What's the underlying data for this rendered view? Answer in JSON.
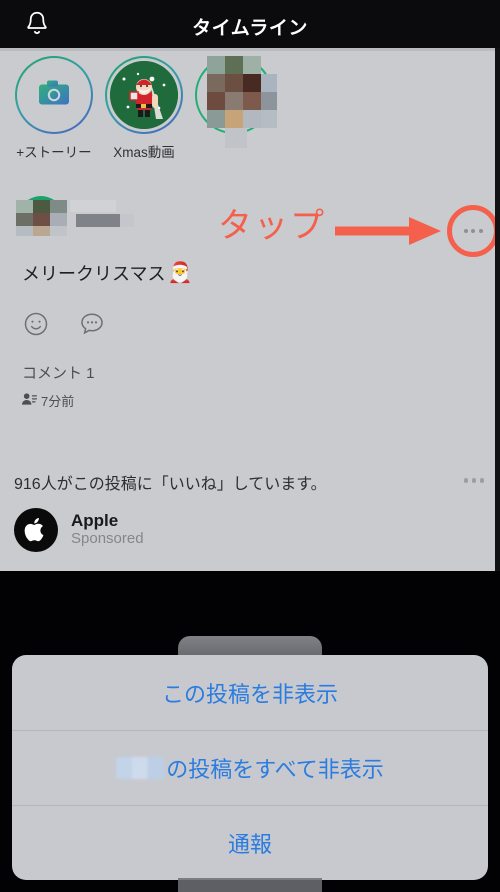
{
  "header": {
    "title": "タイムライン",
    "bell_icon": "bell-icon",
    "background": "#0b0b0d",
    "text_color": "#ffffff"
  },
  "stories": [
    {
      "label": "+ストーリー",
      "icon": "camera-icon",
      "type": "add-story",
      "ring_colors": [
        "#20a26a",
        "#4a62c0"
      ]
    },
    {
      "label": "Xmas動画",
      "icon": "santa-avatar",
      "type": "story",
      "ring_colors": [
        "#20a26a",
        "#4a62c0"
      ]
    },
    {
      "label": "",
      "icon": "censored-avatar",
      "type": "story",
      "ring_colors": [
        "#1fae74",
        "#1fae74"
      ]
    }
  ],
  "post": {
    "author_name_censored": true,
    "avatar": "censored-avatar",
    "body_text": "メリークリスマス",
    "body_emoji": "🎅",
    "reactions": {
      "like_icon": "smiley-face-icon",
      "comment_icon": "comment-bubble-icon"
    },
    "comment_label": "コメント 1",
    "audience_icon": "audience-icon",
    "timestamp": "7分前",
    "menu_icon": "more-options-icon"
  },
  "annotation": {
    "label": "タップ",
    "color": "#f4604c",
    "arrow_icon": "arrow-right-icon",
    "target_icon": "more-options-icon"
  },
  "likes": {
    "text": "916人がこの投稿に「いいね」しています。",
    "count": 916,
    "menu_icon": "more-options-icon"
  },
  "sponsored": {
    "logo_icon": "apple-logo-icon",
    "name": "Apple",
    "subtitle": "Sponsored"
  },
  "action_sheet": {
    "items": [
      {
        "label": "この投稿を非表示",
        "prefix_censored": false
      },
      {
        "label": "の投稿をすべて非表示",
        "prefix_censored": true
      },
      {
        "label": "通報",
        "prefix_censored": false
      }
    ],
    "text_color": "#2a7ce0",
    "background": "#c7c9ce"
  }
}
